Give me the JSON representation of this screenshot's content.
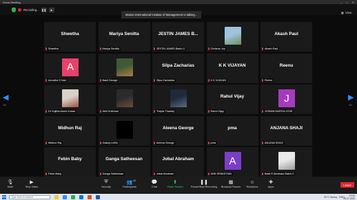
{
  "window": {
    "title": "Zoom Meeting",
    "controls": [
      "–",
      "□",
      "✕"
    ]
  },
  "topbar": {
    "recording_label": "Recording...",
    "pause_label": "❚❚",
    "stop_label": "■",
    "talking_text": "Marian International Institute of Management is talking...",
    "view_label": "View"
  },
  "pagination": {
    "left_page": "4/4",
    "right_page": "4/4"
  },
  "participants": [
    {
      "name": "Shwetha",
      "caption": "Shwetha",
      "type": "name"
    },
    {
      "name": "Mariya Senitta",
      "caption": "Mariya Senitta",
      "type": "name"
    },
    {
      "name": "JESTIN JAMES B...",
      "caption": "JESTIN JAMES Batch C",
      "type": "name"
    },
    {
      "name": "",
      "caption": "Chrisma Joy",
      "type": "photo",
      "colors": [
        "#9ec3dd",
        "#6f8f5a"
      ]
    },
    {
      "name": "Akash Paul",
      "caption": "Akash Paul",
      "type": "name"
    },
    {
      "name": "",
      "caption": "Amrutha S Nair",
      "type": "letter",
      "letter": "A",
      "color": "#e8426a"
    },
    {
      "name": "",
      "caption": "Basil George",
      "type": "photo",
      "colors": [
        "#3f5a33",
        "#b07a4b"
      ]
    },
    {
      "name": "Silpa Zacharias",
      "caption": "Silpa Zacharias",
      "type": "name"
    },
    {
      "name": "K K VIJAYAN",
      "caption": "K K VIJAYAN",
      "type": "name"
    },
    {
      "name": "Reenu",
      "caption": "Reenu",
      "type": "name"
    },
    {
      "name": "",
      "caption": "Dr Sujitha Annie Kurian",
      "type": "photo",
      "colors": [
        "#d9d0c8",
        "#a0523d"
      ]
    },
    {
      "name": "",
      "caption": "Akhi Krishnan",
      "type": "photo",
      "colors": [
        "#2b2b2b",
        "#6b4d3a"
      ]
    },
    {
      "name": "",
      "caption": "Thejas Thamby",
      "type": "photo",
      "colors": [
        "#1d2a3a",
        "#5a6c80"
      ]
    },
    {
      "name": "Rahul Vijay",
      "caption": "Rahul Vijay",
      "type": "name"
    },
    {
      "name": "",
      "caption": "JOSMIN MARIYA JOSE",
      "type": "letter",
      "letter": "J",
      "color": "#a53bbd"
    },
    {
      "name": "Midhun Raj",
      "caption": "Midhun Raj",
      "type": "name"
    },
    {
      "name": "",
      "caption": "Galaxy m30s",
      "type": "black"
    },
    {
      "name": "Aleena George",
      "caption": "Aleena George",
      "type": "name"
    },
    {
      "name": "pma",
      "caption": "pma",
      "type": "name"
    },
    {
      "name": "ANJANA SHAJI",
      "caption": "ANJANA SHAJI",
      "type": "name"
    },
    {
      "name": "Febin Baby",
      "caption": "Febin Baby",
      "type": "name"
    },
    {
      "name": "Ganga Satheesan",
      "caption": "Ganga Satheesan",
      "type": "name"
    },
    {
      "name": "Jobal Abraham",
      "caption": "Jobal Abraham",
      "type": "name"
    },
    {
      "name": "",
      "caption": "ANN SEBASTIAN",
      "type": "letter",
      "letter": "A",
      "color": "#7a3ec9"
    },
    {
      "name": "",
      "caption": "Basil R Abraham Batch C",
      "type": "photo",
      "colors": [
        "#e9e9e9",
        "#9a9a9a"
      ]
    }
  ],
  "toolbar": {
    "items": [
      {
        "label": "Mute",
        "icon": "microphone-icon",
        "glyph": "🎙"
      },
      {
        "label": "Stop Video",
        "icon": "video-camera-icon",
        "glyph": "▶"
      },
      {
        "label": "Security",
        "icon": "shield-icon",
        "glyph": "⛨"
      },
      {
        "label": "Participants",
        "icon": "participants-icon",
        "glyph": "👥",
        "badge": "44"
      },
      {
        "label": "Chat",
        "icon": "chat-icon",
        "glyph": "💬"
      },
      {
        "label": "Share Screen",
        "icon": "share-screen-icon",
        "glyph": "⬆"
      },
      {
        "label": "Pause/Stop Recording",
        "icon": "recording-icon",
        "glyph": "❚❚"
      },
      {
        "label": "Breakout Rooms",
        "icon": "breakout-rooms-icon",
        "glyph": "▦"
      },
      {
        "label": "Reactions",
        "icon": "reactions-icon",
        "glyph": "☺"
      },
      {
        "label": "Apps",
        "icon": "apps-icon",
        "glyph": "✚"
      }
    ],
    "leave_label": "Leave"
  },
  "taskbar": {
    "search_placeholder": "Type here to search",
    "weather": "31°C Sunny",
    "language": "ENG",
    "time": "10:42",
    "date": "28-07-2022"
  },
  "colors": {
    "accent": "#2d8cff",
    "share_green": "#2bd36a",
    "leave_red": "#e0262e",
    "muted_red": "#e23a3a"
  }
}
